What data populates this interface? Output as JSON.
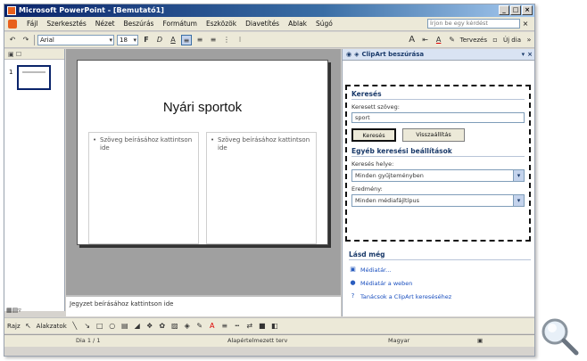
{
  "window": {
    "title": "Microsoft PowerPoint - [Bemutató1]",
    "controls": [
      "_",
      "□",
      "×"
    ]
  },
  "menu": {
    "items": [
      "Fájl",
      "Szerkesztés",
      "Nézet",
      "Beszúrás",
      "Formátum",
      "Eszközök",
      "Diavetítés",
      "Ablak",
      "Súgó"
    ],
    "help_placeholder": "Írjon be egy kérdést",
    "close": "×"
  },
  "toolbar": {
    "font_name": "Arial",
    "font_size": "18",
    "bold": "F",
    "italic": "D",
    "underline": "A",
    "design_label": "Tervezés",
    "new_slide_label": "Új dia"
  },
  "slide": {
    "number": "1",
    "title": "Nyári sportok",
    "placeholder_left": "Szöveg beírásához kattintson ide",
    "placeholder_right": "Szöveg beírásához kattintson ide"
  },
  "notes": {
    "placeholder": "Jegyzet beírásához kattintson ide"
  },
  "taskpane": {
    "title": "ClipArt beszúrása",
    "search_section": "Keresés",
    "search_text_label": "Keresett szöveg:",
    "search_text_value": "sport",
    "search_button": "Keresés",
    "restore_button": "Visszaállítás",
    "other_options": "Egyéb keresési beállítások",
    "search_in_label": "Keresés helye:",
    "search_in_value": "Minden gyűjteményben",
    "results_label": "Eredmény:",
    "results_value": "Minden médiafájltípus",
    "see_also": "Lásd még",
    "links": [
      "Médiatár...",
      "Médiatár a weben",
      "Tanácsok a ClipArt kereséséhez"
    ]
  },
  "drawing": {
    "draw_label": "Rajz",
    "autoshapes_label": "Alakzatok"
  },
  "status": {
    "slide_info": "Dia 1 / 1",
    "design": "Alapértelmezett terv",
    "language": "Magyar"
  },
  "colors": {
    "title_bar": "#0a246a",
    "chrome": "#ece9d8",
    "link": "#1a4fbf",
    "taskpane_header": "#d9e3f3"
  }
}
